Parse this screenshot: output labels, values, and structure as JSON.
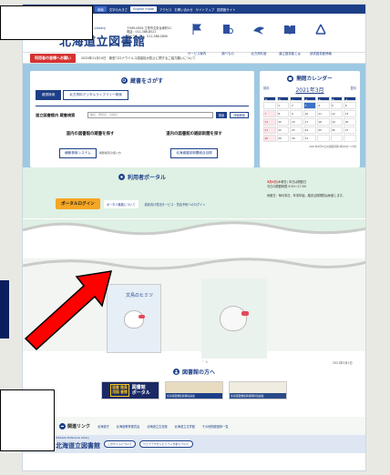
{
  "topbar": {
    "site_map": "サイト情報",
    "search_placeholder": "Enhanced by Google",
    "search_btn": "検索",
    "sizes": "文字の大きさ",
    "english": "English mode",
    "links": [
      "アクセス",
      "お問い合わせ",
      "サイトマップ",
      "図書館サイト"
    ]
  },
  "header": {
    "logo_small": "Hokkaido Prefectural Library",
    "logo": "北海道立図書館",
    "address": "〒069-0834 江別市文京台東町41\n電話：011-386-8521\nファクシミリ：011-386-2890",
    "navs": [
      "サービス案内",
      "調べもの",
      "北方資料室",
      "道立図書館とは",
      "読書図書館情報"
    ]
  },
  "notice": {
    "tag": "利用者の皆様へお願い",
    "text": "2020年11月10日　新型コロナウイルス感染拡大防止に関するご協力願いについて"
  },
  "search": {
    "title": "蔵書をさがす",
    "tab_active": "蔵書検索",
    "tab_inactive": "北方資料デジタルライブラリー検索",
    "label": "道立図書館内 蔵書検索",
    "placeholder": "書名、著者名、出版社",
    "btn": "検索",
    "adv_btn": "詳細検索",
    "col1_head": "道内の図書館の蔵書を探す",
    "col1_btn": "横断検索システム",
    "col1_note": "横断検索の使い方",
    "col2_head": "道内の図書館の雑誌新聞を探す",
    "col2_btn": "北海道雑誌新聞総合目録"
  },
  "calendar": {
    "title": "開館カレンダー",
    "prev": "前月",
    "month": "2021年3月",
    "next": "翌月",
    "days": [
      "日",
      "月",
      "火",
      "水",
      "木",
      "金",
      "土"
    ],
    "cells": [
      "",
      "1",
      "2",
      "3",
      "4",
      "5",
      "6",
      "7",
      "8",
      "9",
      "10",
      "11",
      "12",
      "13",
      "14",
      "15",
      "16",
      "17",
      "18",
      "19",
      "20",
      "21",
      "22",
      "23",
      "24",
      "25",
      "26",
      "27",
      "28",
      "29",
      "30",
      "31",
      "",
      "",
      ""
    ],
    "foot": "2021年3月31日の開館時間 9時30分〜17時"
  },
  "portal": {
    "title": "利用者ポータル",
    "login": "ポータルログイン",
    "about": "ポータル機能について",
    "more": "道民向け貸出サービス・貸出予約へのログイン",
    "news_date": "3月4日",
    "news_tag": "(木曜日)",
    "news_sub": "本日は開館日",
    "news_line": "今日の開館時間 9:30〜17:00",
    "news_body": "休館日：毎月末日、年末年始、蔵書点検期間は休館します。"
  },
  "books": {
    "cover_title": "文鳥のヒミツ",
    "icons": "♡  ↻",
    "date": "2021年3月1日"
  },
  "pro": {
    "title": "図書館の方へ",
    "b1_k1": "図書",
    "b1_k2": "館員",
    "b1_k3": "用図",
    "b1_k4": "書館",
    "b1_p1": "図書館",
    "b1_p2": "ポータル",
    "b2_label": "北海道図書館振興協議会",
    "b3_label": "北海道図書館情報資料協議会"
  },
  "links": {
    "title": "関連リンク",
    "items": [
      "北海道庁",
      "北海道教育委員会",
      "北海道立文書館",
      "北海道立文学館",
      "その他関連団体一覧"
    ]
  },
  "footer": {
    "small": "Hokkaido Prefectural Library",
    "logo": "北海道立図書館",
    "b1": "このサイトについて",
    "b2": "ウェブアクセシビリティ方針について"
  },
  "colors": {
    "brand": "#1d3f87",
    "alert": "#d63131",
    "arrow": "#ff0000",
    "hero": "#9ec9e3",
    "portal": "#dff0e4"
  }
}
